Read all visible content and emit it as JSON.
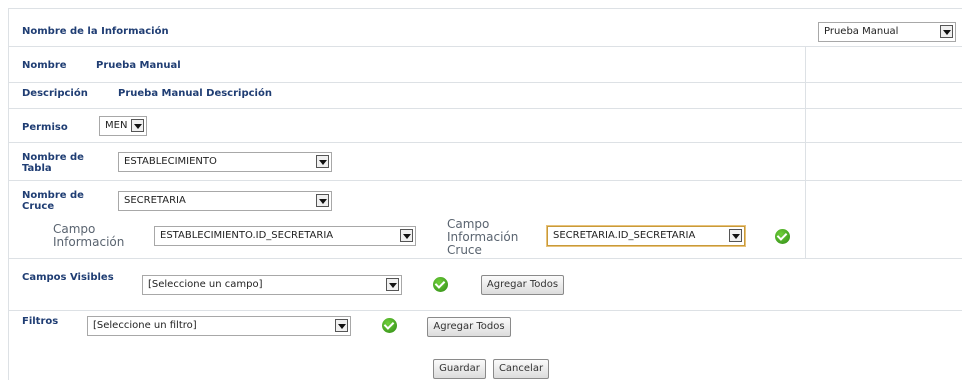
{
  "header": {
    "label": "Nombre de la Información",
    "selected": "Prueba Manual"
  },
  "nombre": {
    "label": "Nombre",
    "value": "Prueba Manual"
  },
  "descripcion": {
    "label": "Descripción",
    "value": "Prueba Manual Descripción"
  },
  "permiso": {
    "label": "Permiso",
    "selected": "MEN"
  },
  "tabla": {
    "label": "Nombre de Tabla",
    "selected": "ESTABLECIMIENTO"
  },
  "cruce": {
    "label": "Nombre de Cruce",
    "selected": "SECRETARIA"
  },
  "campo_info": {
    "label": "Campo Información",
    "selected": "ESTABLECIMIENTO.ID_SECRETARIA"
  },
  "campo_cruce": {
    "label": "Campo Información Cruce",
    "selected": "SECRETARIA.ID_SECRETARIA"
  },
  "campos_visibles": {
    "label": "Campos Visibles",
    "selected": "[Seleccione un campo]",
    "button": "Agregar Todos"
  },
  "filtros": {
    "label": "Filtros",
    "selected": "[Seleccione un filtro]",
    "button": "Agregar Todos"
  },
  "actions": {
    "save": "Guardar",
    "cancel": "Cancelar"
  },
  "icons": {
    "check": "check-icon",
    "dropdown": "chevron-down-icon"
  },
  "colors": {
    "label": "#1f3d73",
    "accent_border": "#c89a3a",
    "check": "#3a9a1f"
  }
}
